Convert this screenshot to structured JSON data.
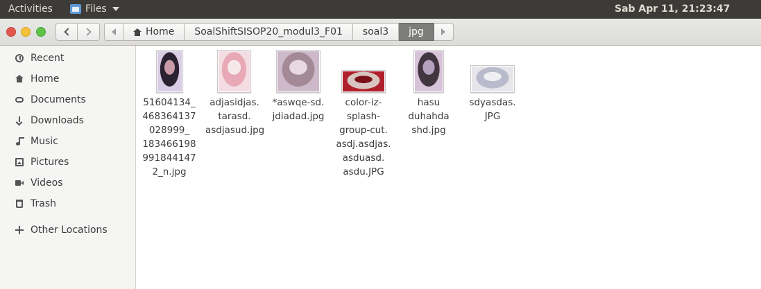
{
  "top_panel": {
    "activities": "Activities",
    "app_name": "Files",
    "clock": "Sab Apr 11, 21:23:47"
  },
  "breadcrumbs": [
    {
      "label": "Home",
      "active": false
    },
    {
      "label": "SoalShiftSISOP20_modul3_F01",
      "active": false
    },
    {
      "label": "soal3",
      "active": false
    },
    {
      "label": "jpg",
      "active": true
    }
  ],
  "sidebar": {
    "items": [
      {
        "label": "Recent",
        "icon": "clock-icon"
      },
      {
        "label": "Home",
        "icon": "home-icon"
      },
      {
        "label": "Documents",
        "icon": "documents-icon"
      },
      {
        "label": "Downloads",
        "icon": "download-icon"
      },
      {
        "label": "Music",
        "icon": "music-icon"
      },
      {
        "label": "Pictures",
        "icon": "pictures-icon"
      },
      {
        "label": "Videos",
        "icon": "videos-icon"
      },
      {
        "label": "Trash",
        "icon": "trash-icon"
      }
    ],
    "other_locations": "Other Locations"
  },
  "files": [
    {
      "name": "51604134_\n468364137\n028999_\n183466198\n991844147\n2_n.jpg",
      "thumb_colors": [
        "#d9cde6",
        "#2a2230",
        "#c89aa5"
      ]
    },
    {
      "name": "adjasidjas.\ntarasd.\nasdjasud.jpg",
      "thumb_colors": [
        "#f3dde2",
        "#e8a8b6",
        "#f6e9ea"
      ]
    },
    {
      "name": "*aswqe-sd.\njdiadad.jpg",
      "thumb_colors": [
        "#cdb9c9",
        "#a48a96",
        "#e7d9df"
      ]
    },
    {
      "name": "color-iz-\nsplash-\ngroup-cut.\nasdj.asdjas.\nasduasd.\nasdu.JPG",
      "thumb_colors": [
        "#b0202c",
        "#d8c4c0",
        "#7a1018"
      ]
    },
    {
      "name": "hasu\nduhahda\nshd.jpg",
      "thumb_colors": [
        "#d6c3d8",
        "#41363f",
        "#b4a1c0"
      ]
    },
    {
      "name": "sdyasdas.\nJPG",
      "thumb_colors": [
        "#e6e6ea",
        "#b9bacb",
        "#f0f0f2"
      ]
    }
  ]
}
